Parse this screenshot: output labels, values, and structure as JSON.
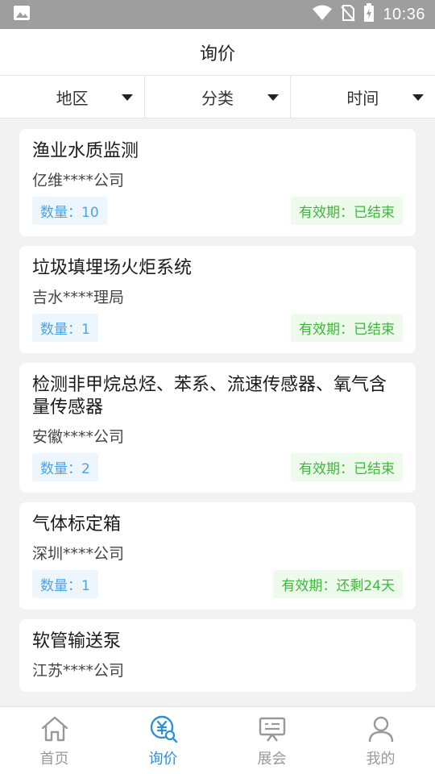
{
  "status_bar": {
    "time": "10:36"
  },
  "header": {
    "title": "询价"
  },
  "filters": [
    {
      "label": "地区"
    },
    {
      "label": "分类"
    },
    {
      "label": "时间"
    }
  ],
  "cards": [
    {
      "title": "渔业水质监测",
      "company": "亿维****公司",
      "quantity": "数量：10",
      "validity": "有效期：已结束"
    },
    {
      "title": "垃圾填埋场火炬系统",
      "company": "吉水****理局",
      "quantity": "数量：1",
      "validity": "有效期：已结束"
    },
    {
      "title": "检测非甲烷总烃、苯系、流速传感器、氧气含量传感器",
      "company": "安徽****公司",
      "quantity": "数量：2",
      "validity": "有效期：已结束"
    },
    {
      "title": "气体标定箱",
      "company": "深圳****公司",
      "quantity": "数量：1",
      "validity": "有效期：还剩24天"
    },
    {
      "title": "软管输送泵",
      "company": "江苏****公司",
      "quantity": "",
      "validity": ""
    }
  ],
  "bottom_nav": [
    {
      "label": "首页",
      "icon": "home-icon",
      "active": false
    },
    {
      "label": "询价",
      "icon": "inquiry-icon",
      "active": true
    },
    {
      "label": "展会",
      "icon": "exhibition-icon",
      "active": false
    },
    {
      "label": "我的",
      "icon": "profile-icon",
      "active": false
    }
  ],
  "colors": {
    "accent": "#2f8fd6",
    "quantity_text": "#4aa3e8",
    "validity_text": "#3cb93a",
    "status_bar": "#9e9e9e"
  }
}
